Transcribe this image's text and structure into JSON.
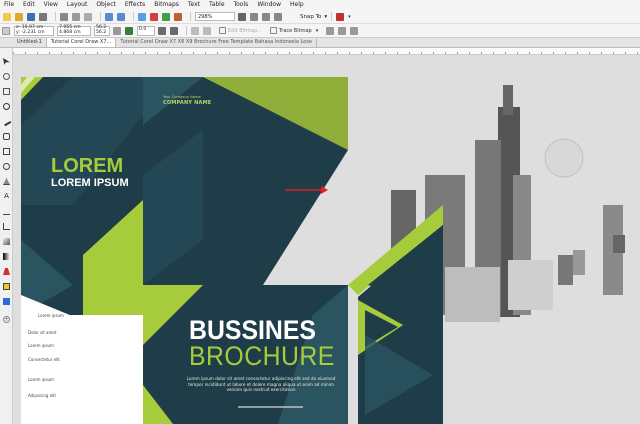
{
  "menu": {
    "items": [
      "File",
      "Edit",
      "View",
      "Layout",
      "Object",
      "Effects",
      "Bitmaps",
      "Text",
      "Table",
      "Tools",
      "Window",
      "Help"
    ]
  },
  "toolbar": {
    "zoom_value": "298%",
    "snap_label": "Snap To"
  },
  "propbar": {
    "x_value": "x: 10.97 cm",
    "y_value": "y: -2.231 cm",
    "w_value": "7.955 cm",
    "h_value": "4.868 cm",
    "scale_w": "56.2",
    "scale_h": "56.2",
    "angle": "0.0",
    "edit_bitmap": "Edit Bitmap...",
    "trace_bitmap": "Trace Bitmap"
  },
  "tabs": [
    {
      "label": "Untitled-1"
    },
    {
      "label": "Tutorial Corel Draw X7..."
    },
    {
      "label": "Tutorial Corel Draw X7 X8 X9 Brochure Free Template Bahasa Indonesia Lose"
    }
  ],
  "brochure": {
    "lorem_title": "LOREM",
    "lorem_subtitle": "LOREM IPSUM",
    "company_small": "Your Company Name",
    "company_name": "COMPANY NAME",
    "headline_1": "BUSSINES",
    "headline_2": "BROCHURE",
    "paragraph": "Lorem ipsum dolor sit amet consectetur adipiscing elit sed do eiusmod tempor incididunt ut labore et dolore magna aliqua ut enim ad minim veniam quis nostrud exercitation",
    "side_lines": [
      "Lorem ipsum",
      "Dolor sit amet",
      "Lorem ipsum",
      "Consectetur elit",
      "Lorem ipsum",
      "Adipiscing elit"
    ]
  },
  "colors": {
    "dark_teal": "#1e3d48",
    "lime": "#a6cc3c",
    "olive": "#8fae3a",
    "arrow": "#e02020"
  }
}
